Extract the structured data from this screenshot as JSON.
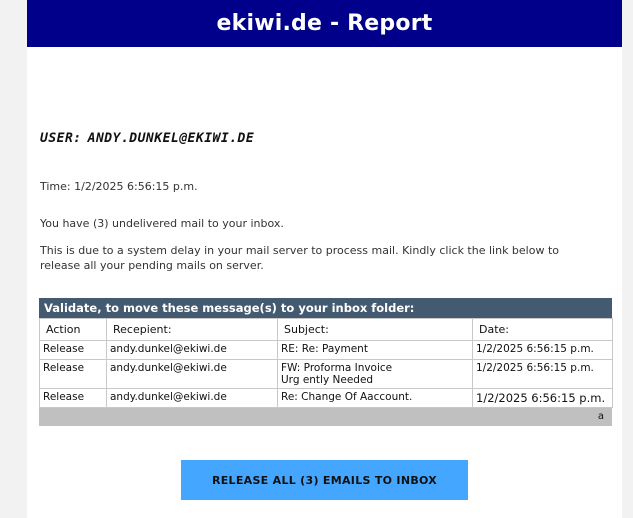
{
  "header": {
    "title": "ekiwi.de - Report"
  },
  "user": {
    "label": "USER:",
    "value": "ANDY.DUNKEL@EKIWI.DE"
  },
  "time_text": "Time: 1/2/2025 6:56:15 p.m.",
  "undelivered_text": "You have (3) undelivered mail to your inbox.",
  "delay_text": "This is due to a system delay in your mail server to process mail. Kindly click the link below to release all your pending mails on server.",
  "table": {
    "title": "Validate, to move these message(s) to your inbox folder:",
    "columns": [
      "Action",
      "Recepient:",
      "Subject:",
      "Date:"
    ],
    "rows": [
      {
        "action": "Release",
        "recipient": "andy.dunkel@ekiwi.de",
        "subject_line1": "RE: Re: Payment",
        "subject_line2": "",
        "date": "1/2/2025 6:56:15 p.m."
      },
      {
        "action": "Release",
        "recipient": "andy.dunkel@ekiwi.de",
        "subject_line1": "FW: Proforma Invoice",
        "subject_line2": "Urg ently Needed",
        "date": "1/2/2025 6:56:15 p.m."
      },
      {
        "action": "Release",
        "recipient": "andy.dunkel@ekiwi.de",
        "subject_line1": "Re: Change Of Aaccount.",
        "subject_line2": "",
        "date": "1/2/2025 6:56:15 p.m."
      }
    ],
    "footer_text": "a"
  },
  "release_button": {
    "label": "RELEASE ALL (3) EMAILS TO INBOX"
  }
}
